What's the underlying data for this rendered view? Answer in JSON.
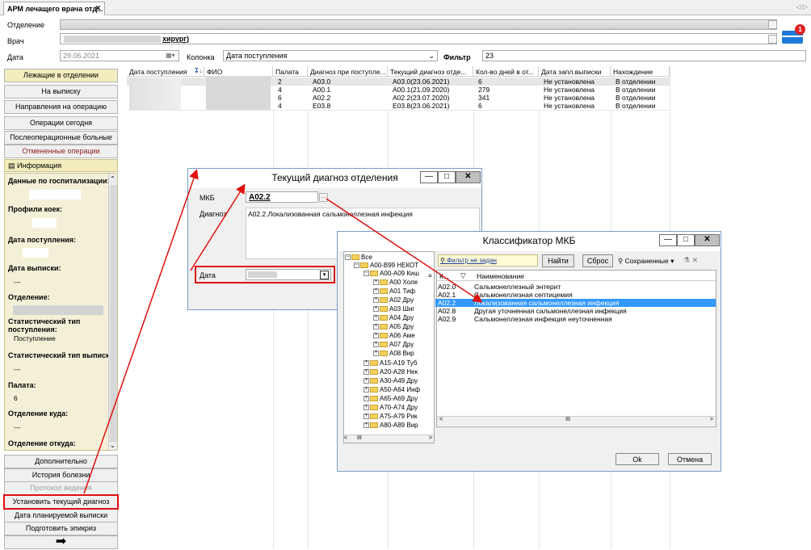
{
  "tab": {
    "title": "АРМ лечащего врача отд...",
    "close": "✕"
  },
  "filters": {
    "department_label": "Отделение",
    "doctor_label": "Врач",
    "doctor_value": "хирург)",
    "date_label": "Дата",
    "date_value": "29.06.2021",
    "column_label": "Колонка",
    "column_value": "Дата поступления",
    "filter_label": "Фильтр",
    "filter_value": "23"
  },
  "left_buttons": [
    "Лежащие в отделении",
    "На выписку",
    "Направления на операцию",
    "Операции сегодня",
    "Послеоперационные больные",
    "Отмененные операции"
  ],
  "info": {
    "header": "Информация",
    "hosp_label": "Данные по госпитализации:",
    "profiles_label": "Профили коек:",
    "admit_label": "Дата поступления:",
    "discharge_label": "Дата выписки:",
    "discharge_value": "---",
    "dept_label": "Отделение:",
    "stat_in_label": "Статистический тип поступления:",
    "stat_in_value": "Поступление",
    "stat_out_label": "Статистический тип выписки:",
    "stat_out_value": "---",
    "ward_label": "Палата:",
    "ward_value": "6",
    "to_label": "Отделение куда:",
    "to_value": "---",
    "from_label": "Отделение откуда:"
  },
  "bottom_buttons": [
    "Дополнительно",
    "История болезни",
    "Протокол ведения",
    "Установить текущий диагноз",
    "Дата планируемой выписки",
    "Подготовить эпикриз"
  ],
  "grid": {
    "headers": [
      "Дата поступления",
      "ФИО",
      "Палата",
      "Диагноз при поступле...",
      "Текущий диагноз отде...",
      "Кол-во дней в от...",
      "Дата запл.выписки",
      "Нахождение"
    ],
    "rows": [
      [
        "2",
        "A03.0",
        "A03.0(23.06.2021)",
        "6",
        "Не установлена",
        "В отделении"
      ],
      [
        "4",
        "A00.1",
        "A00.1(21.09.2020)",
        "279",
        "Не установлена",
        "В отделении"
      ],
      [
        "6",
        "A02.2",
        "A02.2(23.07.2020)",
        "341",
        "Не установлена",
        "В отделении"
      ],
      [
        "4",
        "E03.8",
        "E03.8(23.06.2021)",
        "6",
        "Не установлена",
        "В отделении"
      ]
    ]
  },
  "diag_dialog": {
    "title": "Текущий диагноз отделения",
    "mkb_label": "МКБ",
    "mkb_value": "A02.2",
    "diag_label": "Диагноз",
    "diag_value": "A02.2.Локализованная сальмонеллезная инфекция",
    "date_label": "Дата"
  },
  "mkb_dialog": {
    "title": "Классификатор МКБ",
    "filter_text": "Фильтр не задан",
    "find": "Найти",
    "reset": "Сброс",
    "saved": "Сохраненные",
    "col_code": "К...",
    "col_name": "Наименование",
    "tree": [
      "Все",
      "A00-B99 НЕКОТ",
      "A00-A09 Киш",
      "A00 Холе",
      "A01 Тиф",
      "A02 Дру",
      "A03 Шиг",
      "A04 Дру",
      "A05 Дру",
      "A06 Аме",
      "A07 Дру",
      "A08 Вир",
      "A15-A19 Туб",
      "A20-A28 Нек",
      "A30-A49 Дру",
      "A50-A64 Инф",
      "A65-A69 Дру",
      "A70-A74 Дру",
      "A75-A79 Рик",
      "A80-A89 Вир"
    ],
    "list": [
      [
        "A02.0",
        "Сальмонеллезный энтерит"
      ],
      [
        "A02.1",
        "Сальмонеллезная септицемия"
      ],
      [
        "A02.2",
        "Локализованная сальмонеллезная инфекция"
      ],
      [
        "A02.8",
        "Другая уточненная сальмонеллезная инфекция"
      ],
      [
        "A02.9",
        "Сальмонеллезная инфекция неуточненная"
      ]
    ],
    "ok": "Ok",
    "cancel": "Отмена"
  },
  "notify_count": "1"
}
